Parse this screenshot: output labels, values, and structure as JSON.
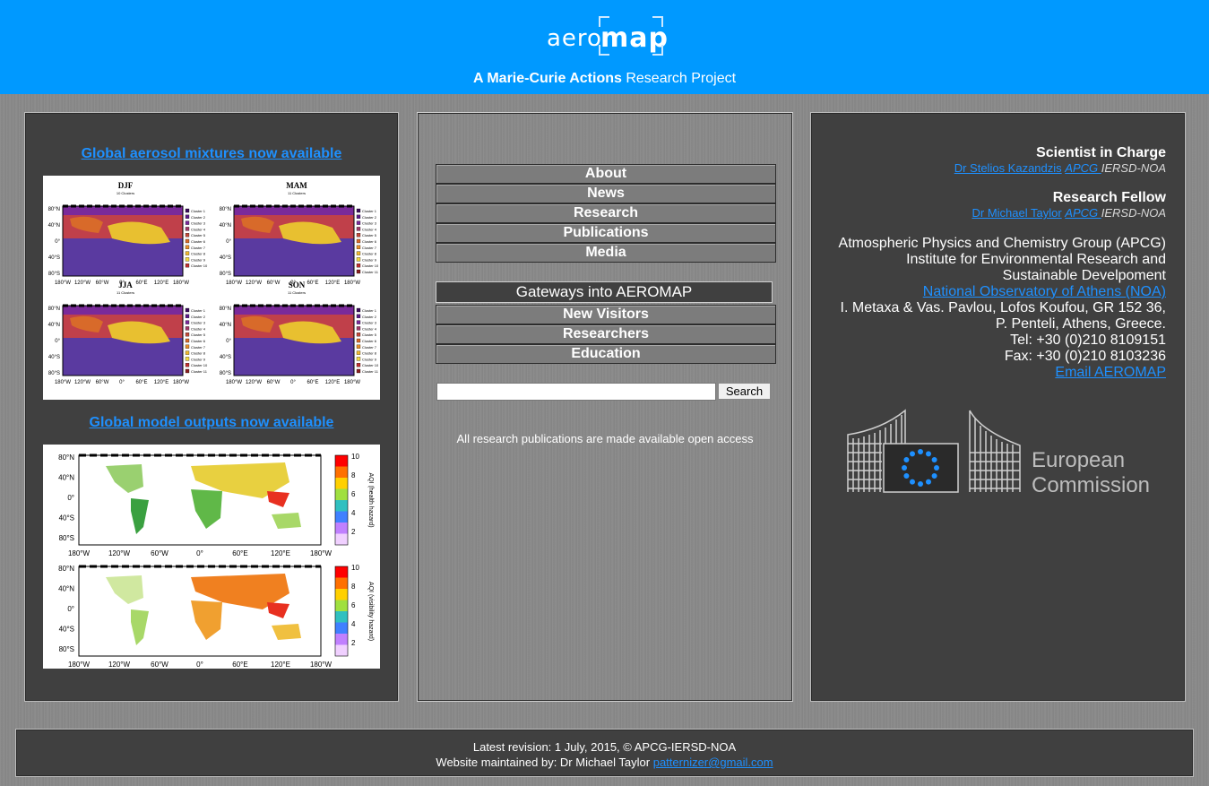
{
  "header": {
    "logo_prefix": "aero",
    "logo_suffix": "map",
    "tagline_bold": "A Marie-Curie Actions",
    "tagline_rest": " Research Project",
    "colors": {
      "header_bg": "#0099ff",
      "panel_bg": "#404040",
      "link": "#1e90ff"
    }
  },
  "left": {
    "feature1_link": "Global aerosol mixtures now available",
    "feature1_maps": [
      {
        "title": "DJF",
        "subtitle": "10 Clusters",
        "legend": [
          "Cluster 1",
          "Cluster 2",
          "Cluster 3",
          "Cluster 4",
          "Cluster 5",
          "Cluster 6",
          "Cluster 7",
          "Cluster 8",
          "Cluster 9",
          "Cluster 10"
        ]
      },
      {
        "title": "MAM",
        "subtitle": "11 Clusters",
        "legend": [
          "Cluster 1",
          "Cluster 2",
          "Cluster 3",
          "Cluster 4",
          "Cluster 5",
          "Cluster 6",
          "Cluster 7",
          "Cluster 8",
          "Cluster 9",
          "Cluster 10",
          "Cluster 11"
        ]
      },
      {
        "title": "JJA",
        "subtitle": "11 Clusters",
        "legend": [
          "Cluster 1",
          "Cluster 2",
          "Cluster 3",
          "Cluster 4",
          "Cluster 5",
          "Cluster 6",
          "Cluster 7",
          "Cluster 8",
          "Cluster 9",
          "Cluster 10",
          "Cluster 11"
        ]
      },
      {
        "title": "SON",
        "subtitle": "11 Clusters",
        "legend": [
          "Cluster 1",
          "Cluster 2",
          "Cluster 3",
          "Cluster 4",
          "Cluster 5",
          "Cluster 6",
          "Cluster 7",
          "Cluster 8",
          "Cluster 9",
          "Cluster 10",
          "Cluster 11"
        ]
      }
    ],
    "feature1_lat_ticks": [
      "80°N",
      "40°N",
      "0°",
      "40°S",
      "80°S"
    ],
    "feature1_lon_ticks": [
      "180°W",
      "120°W",
      "60°W",
      "0°",
      "60°E",
      "120°E",
      "180°W"
    ],
    "feature2_link": "Global model outputs now available",
    "feature2_maps": [
      {
        "colorbar_label": "AQI (health hazard)"
      },
      {
        "colorbar_label": "AQI (visibility hazard)"
      }
    ],
    "feature2_lat_ticks": [
      "80°N",
      "40°N",
      "0°",
      "40°S",
      "80°S"
    ],
    "feature2_lon_ticks": [
      "180°W",
      "120°W",
      "60°W",
      "0°",
      "60°E",
      "120°E",
      "180°W"
    ],
    "feature2_colorbar_ticks": [
      "10",
      "8",
      "6",
      "4",
      "2"
    ]
  },
  "middle": {
    "nav": [
      "About",
      "News",
      "Research",
      "Publications",
      "Media"
    ],
    "gateway_title": "Gateways into AEROMAP",
    "gateways": [
      "New Visitors",
      "Researchers",
      "Education"
    ],
    "search_value": "",
    "search_button": "Search",
    "note": "All research publications are made available open access"
  },
  "right": {
    "scientist_heading": "Scientist in Charge",
    "scientist_name": "Dr Stelios Kazandzis",
    "scientist_apcg": "APCG ",
    "scientist_org": "IERSD-NOA",
    "fellow_heading": "Research Fellow",
    "fellow_name": "Dr Michael Taylor",
    "fellow_apcg": "APCG ",
    "fellow_org": "IERSD-NOA",
    "address": [
      "Atmospheric Physics and Chemistry Group (APCG)",
      "Institute for Environmental Research and",
      "Sustainable Develpoment"
    ],
    "noa_link": "National Observatory of Athens (NOA)",
    "address2": [
      "I. Metaxa & Vas. Pavlou, Lofos Koufou, GR 152 36,",
      "P. Penteli, Athens, Greece.",
      "Tel:  +30 (0)210 8109151",
      "Fax: +30 (0)210 8103236"
    ],
    "email_link": "Email AEROMAP",
    "ec_logo_line1": "European",
    "ec_logo_line2": "Commission"
  },
  "footer": {
    "revision": "Latest revision: 1 July, 2015, © APCG-IERSD-NOA",
    "maintained": "Website maintained by: Dr Michael Taylor ",
    "email": "patternizer@gmail.com"
  }
}
